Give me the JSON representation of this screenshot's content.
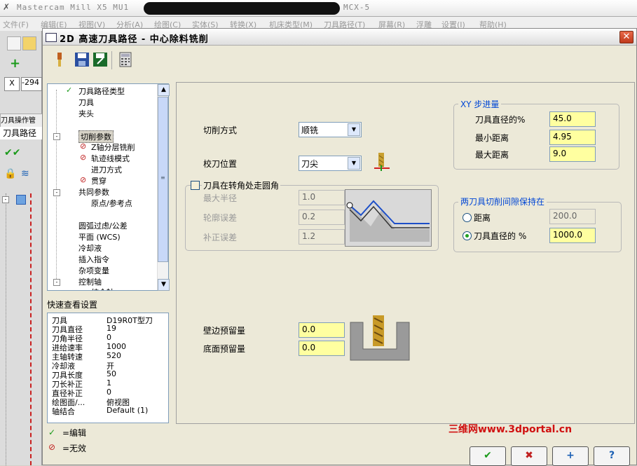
{
  "app": {
    "title_left": "Mastercam Mill X5 MU1",
    "title_right": "MCX-5",
    "menu": [
      "文件(F)",
      "编辑(E)",
      "视图(V)",
      "分析(A)",
      "绘图(C)",
      "实体(S)",
      "转换(X)",
      "机床类型(M)",
      "刀具路径(T)",
      "屏幕(R)",
      "浮雕",
      "设置(I)",
      "帮助(H)"
    ],
    "coord_label": "X",
    "coord_value": "-294",
    "ops_tab": "刀具操作管",
    "ops_label": "刀具路径"
  },
  "dialog": {
    "title": "2D 高速刀具路径 - 中心除料铣削",
    "close": "✕"
  },
  "tree": [
    {
      "label": "刀具路径类型",
      "status": "check"
    },
    {
      "label": "刀具",
      "status": ""
    },
    {
      "label": "夹头",
      "status": ""
    },
    {
      "label": "",
      "status": ""
    },
    {
      "label": "切削参数",
      "status": "selected"
    },
    {
      "label": "Z轴分层铣削",
      "status": "invalid"
    },
    {
      "label": "轨迹线模式",
      "status": "invalid"
    },
    {
      "label": "进刀方式",
      "status": ""
    },
    {
      "label": "贯穿",
      "status": "invalid"
    },
    {
      "label": "共同参数",
      "status": ""
    },
    {
      "label": "原点/参考点",
      "status": ""
    },
    {
      "label": "",
      "status": ""
    },
    {
      "label": "圆弧过虑/公差",
      "status": ""
    },
    {
      "label": "平面 (WCS)",
      "status": ""
    },
    {
      "label": "冷却液",
      "status": ""
    },
    {
      "label": "插入指令",
      "status": ""
    },
    {
      "label": "杂项变量",
      "status": ""
    },
    {
      "label": "控制轴",
      "status": ""
    },
    {
      "label": "统合轴",
      "status": ""
    }
  ],
  "quick": {
    "title": "快速查看设置",
    "rows": [
      {
        "k": "刀具",
        "v": "D19R0T型刀"
      },
      {
        "k": "刀具直径",
        "v": "19"
      },
      {
        "k": "刀角半径",
        "v": "0"
      },
      {
        "k": "进给速率",
        "v": "1000"
      },
      {
        "k": "主轴转速",
        "v": "520"
      },
      {
        "k": "冷却液",
        "v": "开"
      },
      {
        "k": "刀具长度",
        "v": "50"
      },
      {
        "k": "刀长补正",
        "v": "1"
      },
      {
        "k": "直径补正",
        "v": "0"
      },
      {
        "k": "绘图面/...",
        "v": "俯视图"
      },
      {
        "k": "轴结合",
        "v": "Default (1)"
      }
    ]
  },
  "legend": {
    "edit": "=编辑",
    "invalid": "=无效"
  },
  "params": {
    "cut_method_label": "切削方式",
    "cut_method_value": "顺铣",
    "compensation_label": "校刀位置",
    "compensation_value": "刀尖",
    "corner_round_label": "刀具在转角处走圆角",
    "max_radius_label": "最大半径",
    "max_radius_value": "1.0",
    "contour_tol_label": "轮廓误差",
    "contour_tol_value": "0.2",
    "offset_tol_label": "补正误差",
    "offset_tol_value": "1.2",
    "xy_step_title": "XY 步进量",
    "tool_dia_pct_label": "刀具直径的%",
    "tool_dia_pct_value": "45.0",
    "min_dist_label": "最小距离",
    "min_dist_value": "4.95",
    "max_dist_label": "最大距离",
    "max_dist_value": "9.0",
    "gap_title": "两刀具切削间隙保持在",
    "gap_dist_label": "距离",
    "gap_dist_value": "200.0",
    "gap_pct_label": "刀具直径的 %",
    "gap_pct_value": "1000.0",
    "wall_stock_label": "壁边预留量",
    "wall_stock_value": "0.0",
    "floor_stock_label": "底面预留量",
    "floor_stock_value": "0.0"
  },
  "buttons": {
    "ok": "✔",
    "cancel": "✖",
    "apply": "+",
    "help": "?"
  },
  "watermark": "三维网www.3dportal.cn"
}
